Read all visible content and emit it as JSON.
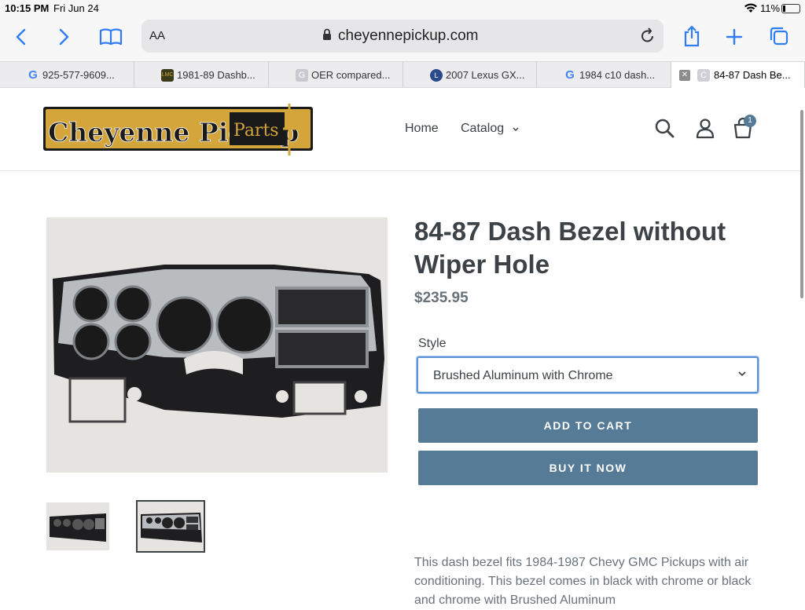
{
  "status_bar": {
    "time": "10:15 PM",
    "date": "Fri Jun 24",
    "battery": "11%"
  },
  "toolbar": {
    "text_size": "AA",
    "url": "cheyennepickup.com"
  },
  "tabs": [
    {
      "title": "925-577-9609...",
      "favicon": "google-icon",
      "color": "#4285f4"
    },
    {
      "title": "1981-89 Dashb...",
      "favicon": "lmc-icon",
      "color": "#3b3b1a"
    },
    {
      "title": "OER compared...",
      "favicon": "g-grey-icon",
      "color": "#c9c9d0"
    },
    {
      "title": "2007 Lexus GX...",
      "favicon": "lexus-icon",
      "color": "#2a4a8c"
    },
    {
      "title": "1984 c10 dash...",
      "favicon": "google-icon",
      "color": "#4285f4"
    },
    {
      "title": "84-87 Dash Be...",
      "favicon": "c-icon",
      "color": "#cfcfd6",
      "active": true
    }
  ],
  "site": {
    "logo_text": "Cheyenne Pickup",
    "logo_sub": "Parts",
    "nav": {
      "home": "Home",
      "catalog": "Catalog"
    },
    "cart_count": "1"
  },
  "product": {
    "title": "84-87 Dash Bezel without Wiper Hole",
    "price": "$235.95",
    "style_label": "Style",
    "style_value": "Brushed Aluminum with Chrome",
    "add_to_cart": "ADD TO CART",
    "buy_now": "BUY IT NOW",
    "description": "This dash bezel fits 1984-1987 Chevy GMC Pickups with air conditioning. This bezel comes in black with chrome or black and chrome with Brushed Aluminum"
  },
  "colors": {
    "button": "#557b97",
    "accent": "#2f7cf6",
    "text": "#3d4246",
    "logo_gold": "#d4a53a"
  }
}
